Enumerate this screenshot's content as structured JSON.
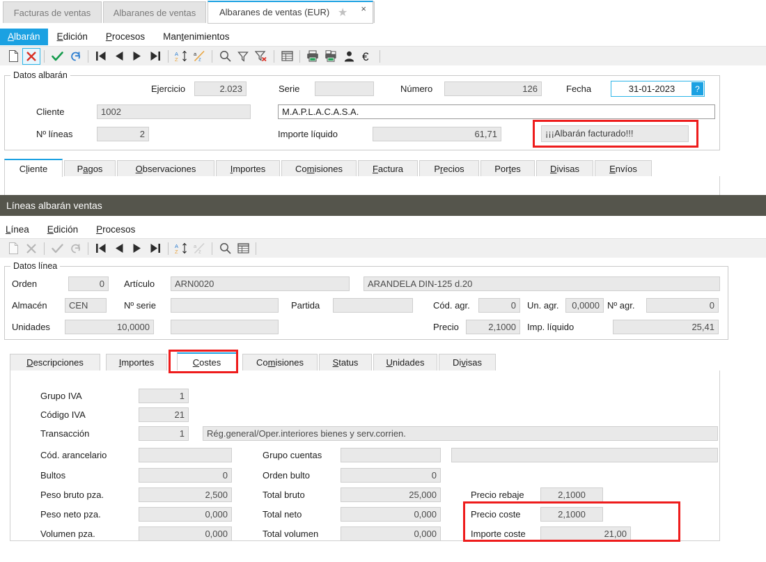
{
  "window_tabs": [
    {
      "label": "Facturas de ventas",
      "active": false
    },
    {
      "label": "Albaranes de ventas",
      "active": false
    },
    {
      "label": "Albaranes de ventas (EUR)",
      "active": true
    }
  ],
  "tab_close_glyph": "×",
  "star_glyph": "★",
  "header_menu": {
    "items": [
      {
        "label": "Albarán",
        "accel": "A",
        "highlight": true
      },
      {
        "label": "Edición",
        "accel": "E",
        "highlight": false
      },
      {
        "label": "Procesos",
        "accel": "P",
        "highlight": false
      },
      {
        "label": "Mantenimientos",
        "accel": "t",
        "highlight": false
      }
    ]
  },
  "header_toolbar": {
    "buttons": [
      {
        "name": "new-document-icon",
        "enabled": true
      },
      {
        "name": "delete-icon",
        "enabled": true,
        "selected": true
      },
      {
        "name": "confirm-check-icon",
        "enabled": true
      },
      {
        "name": "undo-icon",
        "enabled": true
      },
      {
        "name": "first-record-icon",
        "enabled": true
      },
      {
        "name": "previous-record-icon",
        "enabled": true
      },
      {
        "name": "next-record-icon",
        "enabled": true
      },
      {
        "name": "last-record-icon",
        "enabled": true
      },
      {
        "name": "sort-ascending-icon",
        "enabled": true
      },
      {
        "name": "sort-descending-icon",
        "enabled": true
      },
      {
        "name": "search-icon",
        "enabled": true
      },
      {
        "name": "filter-icon",
        "enabled": true
      },
      {
        "name": "clear-filter-icon",
        "enabled": true
      },
      {
        "name": "grid-view-icon",
        "enabled": true
      },
      {
        "name": "print-icon",
        "enabled": true
      },
      {
        "name": "print-preview-icon",
        "enabled": true
      },
      {
        "name": "user-icon",
        "enabled": true
      },
      {
        "name": "euro-icon",
        "enabled": true
      }
    ]
  },
  "datos_albaran": {
    "title": "Datos albarán",
    "ejercicio_label": "Ejercicio",
    "ejercicio_value": "2.023",
    "serie_label": "Serie",
    "serie_value": "",
    "numero_label": "Número",
    "numero_value": "126",
    "fecha_label": "Fecha",
    "fecha_value": "31-01-2023",
    "fecha_help": "?",
    "cliente_label": "Cliente",
    "cliente_code": "1002",
    "cliente_name": "M.A.P.L.A.C.A.S.A.",
    "nlineas_label": "Nº líneas",
    "nlineas_value": "2",
    "importe_liquido_label": "Importe líquido",
    "importe_liquido_value": "61,71",
    "status_message": "¡¡¡Albarán facturado!!!"
  },
  "header_tabs": [
    {
      "label": "Cliente",
      "accel": "l",
      "active": true
    },
    {
      "label": "Pagos",
      "accel": "a",
      "active": false
    },
    {
      "label": "Observaciones",
      "accel": "O",
      "active": false
    },
    {
      "label": "Importes",
      "accel": "I",
      "active": false
    },
    {
      "label": "Comisiones",
      "accel": "m",
      "active": false
    },
    {
      "label": "Factura",
      "accel": "F",
      "active": false
    },
    {
      "label": "Precios",
      "accel": "r",
      "active": false
    },
    {
      "label": "Portes",
      "accel": "t",
      "active": false
    },
    {
      "label": "Divisas",
      "accel": "D",
      "active": false
    },
    {
      "label": "Envíos",
      "accel": "E",
      "active": false
    }
  ],
  "lines_section": {
    "title": "Líneas albarán ventas"
  },
  "line_menu": {
    "items": [
      {
        "label": "Línea",
        "accel": "L"
      },
      {
        "label": "Edición",
        "accel": "E"
      },
      {
        "label": "Procesos",
        "accel": "P"
      }
    ]
  },
  "line_toolbar": {
    "buttons": [
      {
        "name": "new-document-icon",
        "enabled": false
      },
      {
        "name": "delete-icon",
        "enabled": false
      },
      {
        "name": "confirm-check-icon",
        "enabled": false
      },
      {
        "name": "undo-icon",
        "enabled": false
      },
      {
        "name": "first-record-icon",
        "enabled": true
      },
      {
        "name": "previous-record-icon",
        "enabled": true
      },
      {
        "name": "next-record-icon",
        "enabled": true
      },
      {
        "name": "last-record-icon",
        "enabled": true
      },
      {
        "name": "sort-ascending-icon",
        "enabled": true
      },
      {
        "name": "sort-descending-icon",
        "enabled": false
      },
      {
        "name": "search-icon",
        "enabled": true
      },
      {
        "name": "grid-view-icon",
        "enabled": true
      }
    ]
  },
  "datos_linea": {
    "title": "Datos línea",
    "orden_label": "Orden",
    "orden_value": "0",
    "articulo_label": "Artículo",
    "articulo_code": "ARN0020",
    "articulo_desc": "ARANDELA DIN-125 d.20",
    "almacen_label": "Almacén",
    "almacen_value": "CEN",
    "nserie_label": "Nº serie",
    "nserie_value": "",
    "partida_label": "Partida",
    "partida_value": "",
    "cod_agr_label": "Cód. agr.",
    "cod_agr_value": "0",
    "un_agr_label": "Un. agr.",
    "un_agr_value": "0,0000",
    "n_agr_label": "Nº agr.",
    "n_agr_value": "0",
    "unidades_label": "Unidades",
    "unidades_value": "10,0000",
    "unidades_extra": "",
    "precio_label": "Precio",
    "precio_value": "2,1000",
    "imp_liquido_label": "Imp. líquido",
    "imp_liquido_value": "25,41"
  },
  "line_tabs": [
    {
      "label": "Descripciones",
      "accel": "D",
      "active": false
    },
    {
      "label": "Importes",
      "accel": "I",
      "active": false
    },
    {
      "label": "Costes",
      "accel": "C",
      "active": true
    },
    {
      "label": "Comisiones",
      "accel": "m",
      "active": false
    },
    {
      "label": "Status",
      "accel": "S",
      "active": false
    },
    {
      "label": "Unidades",
      "accel": "U",
      "active": false
    },
    {
      "label": "Divisas",
      "accel": "v",
      "active": false
    }
  ],
  "costes_panel": {
    "grupo_iva_label": "Grupo IVA",
    "grupo_iva_value": "1",
    "codigo_iva_label": "Código IVA",
    "codigo_iva_value": "21",
    "transaccion_label": "Transacción",
    "transaccion_value": "1",
    "transaccion_desc": "Rég.general/Oper.interiores bienes y serv.corrien.",
    "cod_arancelario_label": "Cód. arancelario",
    "cod_arancelario_value": "",
    "grupo_cuentas_label": "Grupo cuentas",
    "grupo_cuentas_value": "",
    "grupo_cuentas_desc": "",
    "bultos_label": "Bultos",
    "bultos_value": "0",
    "orden_bulto_label": "Orden bulto",
    "orden_bulto_value": "0",
    "peso_bruto_label": "Peso bruto pza.",
    "peso_bruto_value": "2,500",
    "total_bruto_label": "Total bruto",
    "total_bruto_value": "25,000",
    "precio_rebaje_label": "Precio rebaje",
    "precio_rebaje_value": "2,1000",
    "peso_neto_label": "Peso neto pza.",
    "peso_neto_value": "0,000",
    "total_neto_label": "Total neto",
    "total_neto_value": "0,000",
    "precio_coste_label": "Precio coste",
    "precio_coste_value": "2,1000",
    "volumen_label": "Volumen pza.",
    "volumen_value": "0,000",
    "total_volumen_label": "Total volumen",
    "total_volumen_value": "0,000",
    "importe_coste_label": "Importe coste",
    "importe_coste_value": "21,00"
  },
  "colors": {
    "accent_blue": "#1ba1e2",
    "annotation_red": "#ee1c1c",
    "section_header": "#55554c",
    "field_readonly": "#e9e9e9"
  }
}
